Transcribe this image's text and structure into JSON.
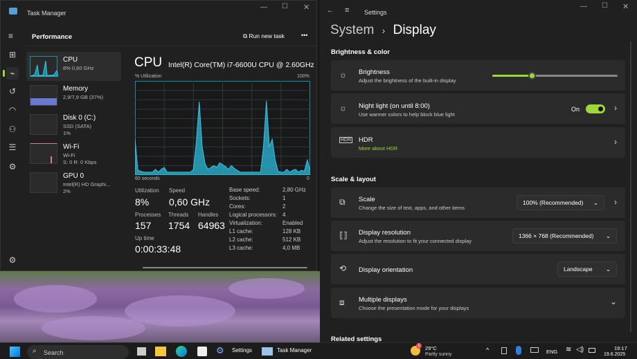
{
  "task_manager": {
    "title": "Task Manager",
    "header": "Performance",
    "run_new_task": "Run new task",
    "more": "•••",
    "side": [
      {
        "name": "CPU",
        "sub1": "8% 0,60 GHz"
      },
      {
        "name": "Memory",
        "sub1": "2,9/7,9 GB (37%)"
      },
      {
        "name": "Disk 0 (C:)",
        "sub1": "SSD (SATA)",
        "sub2": "1%"
      },
      {
        "name": "Wi-Fi",
        "sub1": "Wi-Fi",
        "sub2": "S: 0 R: 0 Kbps"
      },
      {
        "name": "GPU 0",
        "sub1": "Intel(R) HD Graphi...",
        "sub2": "2%"
      }
    ],
    "cpu_title": "CPU",
    "cpu_model": "Intel(R) Core(TM) i7-6600U CPU @ 2.60GHz",
    "util_label": "% Utilization",
    "util_max": "100%",
    "time_label": "60 seconds",
    "time_min": "0",
    "cpu_history": [
      38,
      5,
      4,
      3,
      3,
      3,
      3,
      6,
      3,
      6,
      8,
      3,
      3,
      3,
      3,
      3,
      3,
      3,
      3,
      3,
      6,
      35,
      78,
      30,
      12,
      6,
      8,
      10,
      8,
      13,
      11,
      9,
      6,
      10,
      7,
      5,
      3,
      3,
      3,
      3,
      3,
      3,
      3,
      3,
      30,
      79,
      30,
      38,
      16,
      4,
      3,
      3,
      6,
      3,
      5,
      6,
      3,
      5,
      4,
      16,
      5
    ],
    "stats": {
      "utilization_label": "Utilization",
      "utilization": "8%",
      "speed_label": "Speed",
      "speed": "0,60 GHz",
      "processes_label": "Processes",
      "processes": "157",
      "threads_label": "Threads",
      "threads": "1754",
      "handles_label": "Handles",
      "handles": "64963",
      "uptime_label": "Up time",
      "uptime": "0:00:33:48"
    },
    "specs": [
      [
        "Base speed:",
        "2,80 GHz"
      ],
      [
        "Sockets:",
        "1"
      ],
      [
        "Cores:",
        "2"
      ],
      [
        "Logical processors:",
        "4"
      ],
      [
        "Virtualization:",
        "Enabled"
      ],
      [
        "L1 cache:",
        "128 KB"
      ],
      [
        "L2 cache:",
        "512 KB"
      ],
      [
        "L3 cache:",
        "4,0 MB"
      ]
    ]
  },
  "settings": {
    "title": "Settings",
    "crumb_parent": "System",
    "crumb_sep": "›",
    "crumb_current": "Display",
    "section1": "Brightness & color",
    "brightness": {
      "title": "Brightness",
      "sub": "Adjust the brightness of the built-in display",
      "value": 0.32
    },
    "night": {
      "title": "Night light (on until 8:00)",
      "sub": "Use warmer colors to help block blue light",
      "state": "On"
    },
    "hdr": {
      "title": "HDR",
      "link": "More about HDR"
    },
    "section2": "Scale & layout",
    "scale": {
      "title": "Scale",
      "sub": "Change the size of text, apps, and other items",
      "value": "100% (Recommended)"
    },
    "resolution": {
      "title": "Display resolution",
      "sub": "Adjust the resolution to fit your connected display",
      "value": "1366 × 768 (Recommended)"
    },
    "orientation": {
      "title": "Display orientation",
      "value": "Landscape"
    },
    "multiple": {
      "title": "Multiple displays",
      "sub": "Choose the presentation mode for your displays"
    },
    "section3": "Related settings",
    "accent": "#9fd63a"
  },
  "taskbar": {
    "search": "Search",
    "settings": "Settings",
    "task_manager": "Task Manager",
    "weather_temp": "29°C",
    "weather_desc": "Partly sunny",
    "weather_badge": "1",
    "lang": "ENG",
    "time": "19:17",
    "date": "19.6.2025"
  }
}
